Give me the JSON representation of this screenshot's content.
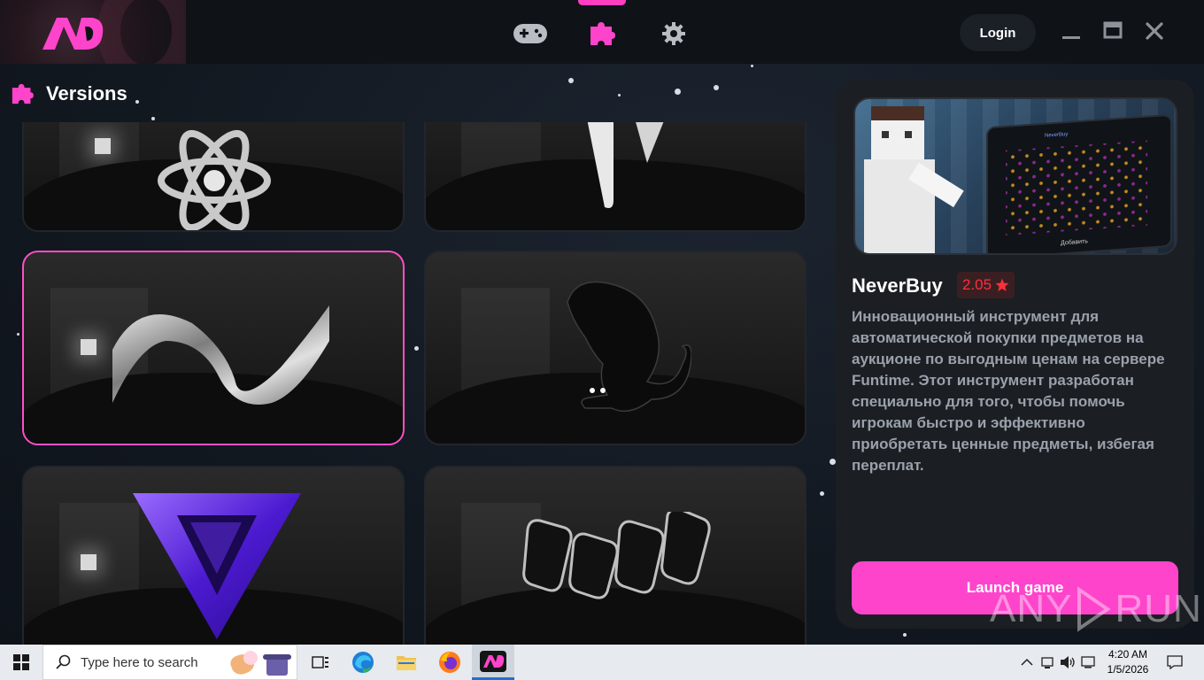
{
  "app": {
    "nav": {
      "games_icon": "gamepad-icon",
      "versions_icon": "puzzle-icon",
      "settings_icon": "gear-icon",
      "active": "versions"
    },
    "login_label": "Login",
    "section": {
      "title": "Versions",
      "icon": "puzzle-icon"
    },
    "cards": [
      {
        "id": "atom",
        "art": "chrome atom logo",
        "selected": false
      },
      {
        "id": "white-v",
        "art": "white chrome V logo",
        "selected": false
      },
      {
        "id": "wave",
        "art": "chrome wave logo",
        "selected": true
      },
      {
        "id": "cat",
        "art": "black cat silhouette",
        "selected": false
      },
      {
        "id": "purple-v",
        "art": "purple V logo",
        "selected": false
      },
      {
        "id": "tiles",
        "art": "black glossy tiles",
        "selected": false
      }
    ],
    "details": {
      "name": "NeverBuy",
      "rating": "2.05",
      "rating_icon": "star-icon",
      "description": "Инновационный инструмент для автоматической покупки предметов на аукционе по выгодным ценам на сервере Funtime. Этот инструмент разработан специально для того, чтобы помочь игрокам быстро и эффективно приобретать ценные предметы, избегая переплат.",
      "preview_caption": "Добавить",
      "preview_header": "NeverBuy",
      "launch_label": "Launch game"
    },
    "watermark": {
      "left": "ANY",
      "right": "RUN"
    },
    "colors": {
      "accent": "#ff44cc",
      "rating": "#ff2e3a"
    }
  },
  "taskbar": {
    "search_placeholder": "Type here to search",
    "apps": [
      "task-view-icon",
      "edge-icon",
      "file-explorer-icon",
      "firefox-icon",
      "neverbuy-app-icon"
    ],
    "time": "4:20 AM",
    "date": "1/5/2026"
  }
}
